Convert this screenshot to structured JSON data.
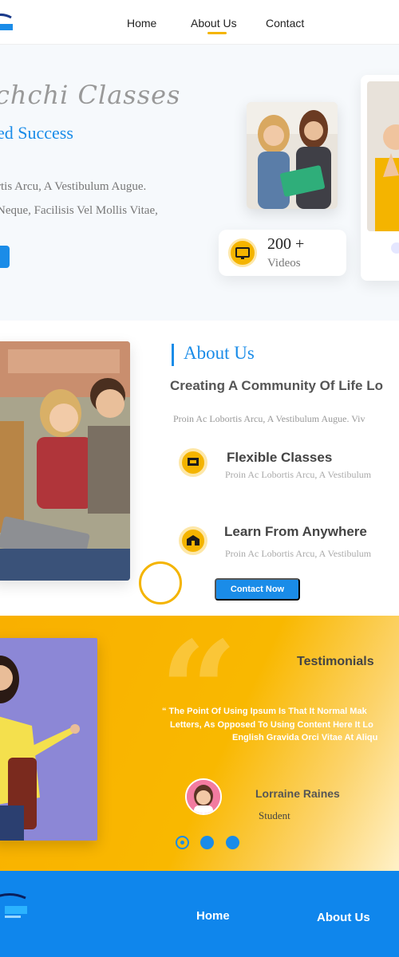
{
  "nav": {
    "items": [
      "Home",
      "About Us",
      "Contact"
    ],
    "active_index": 1
  },
  "hero": {
    "script_title": "chchi Classes",
    "subtitle": "ed Success",
    "para_line1": "rtis Arcu, A Vestibulum Augue.",
    "para_line2": "Neque, Facilisis Vel Mollis Vitae,",
    "stat_value": "200 +",
    "stat_label": "Videos"
  },
  "about": {
    "title": "About Us",
    "heading": "Creating A Community Of Life Lo",
    "paragraph": "Proin Ac Lobortis Arcu, A Vestibulum Augue. Viv",
    "features": [
      {
        "title": "Flexible Classes",
        "text": "Proin Ac Lobortis Arcu, A Vestibulum",
        "icon": "presentation-icon"
      },
      {
        "title": "Learn From Anywhere",
        "text": "Proin Ac Lobortis Arcu, A Vestibulum",
        "icon": "school-icon"
      }
    ],
    "cta_label": "Contact Now"
  },
  "testimonials": {
    "title": "Testimonials",
    "quote_line1": "“ The Point Of Using Ipsum Is That It Normal Mak",
    "quote_line2": "Letters, As Opposed To Using Content Here It Lo",
    "quote_line3": "English Gravida Orci Vitae At Aliqu",
    "name": "Lorraine Raines",
    "role": "Student",
    "slides": 3,
    "active_slide": 0
  },
  "footer": {
    "links": [
      "Home",
      "About Us"
    ]
  },
  "colors": {
    "accent_blue": "#1a8ce8",
    "accent_yellow": "#f4b400",
    "footer_blue": "#0f86ec"
  }
}
